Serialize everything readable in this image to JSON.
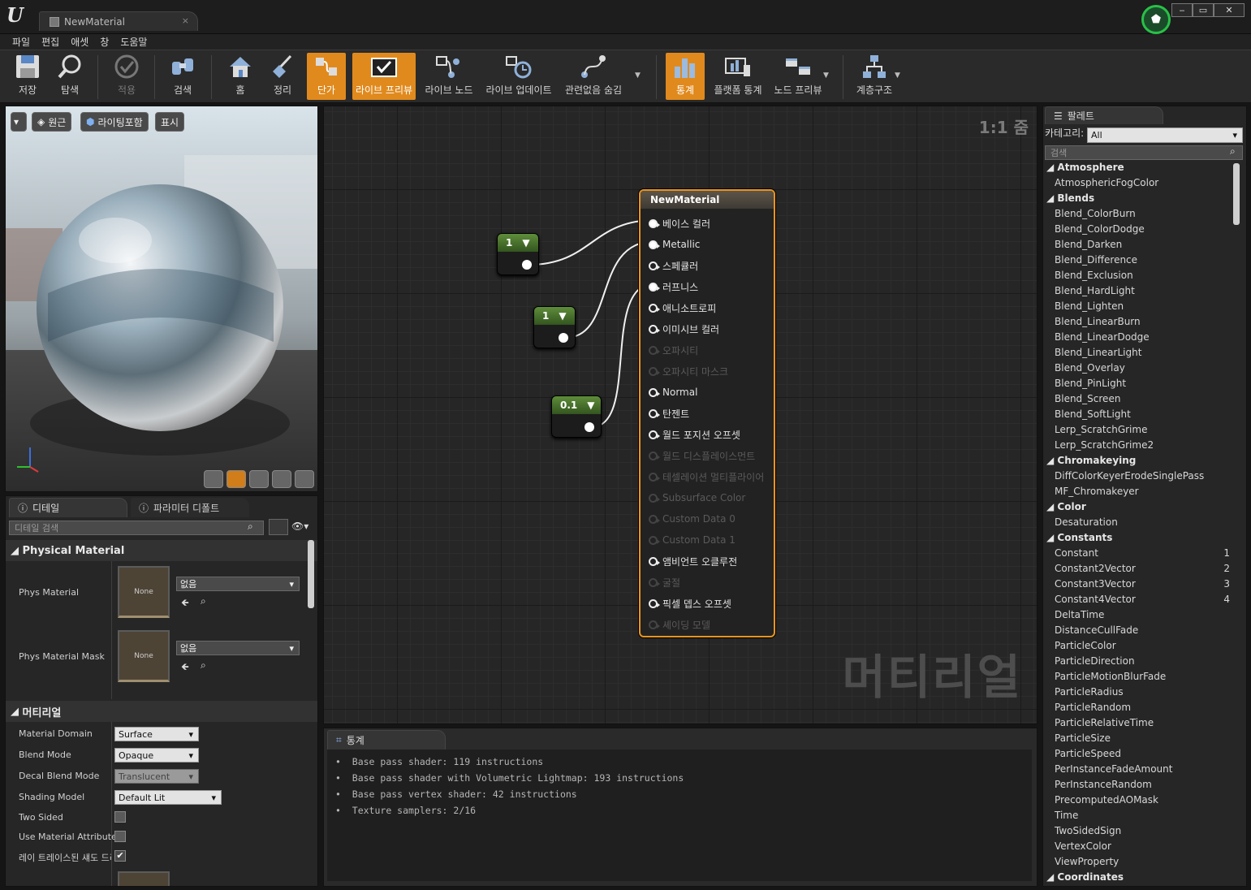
{
  "window": {
    "tab_title": "NewMaterial",
    "tab_close": "×"
  },
  "menu": [
    "파일",
    "편집",
    "애셋",
    "창",
    "도움말"
  ],
  "toolbar": {
    "save": "저장",
    "browse": "탐색",
    "apply": "적용",
    "search": "검색",
    "home": "홈",
    "clean_up": "정리",
    "connectors": "단가",
    "live_preview": "라이브 프리뷰",
    "live_nodes": "라이브 노드",
    "live_update": "라이브 업데이트",
    "hide_unrelated": "관련없음 숨김",
    "stats": "통계",
    "platform_stats": "플랫폼 통계",
    "node_preview": "노드 프리뷰",
    "hierarchy": "계층구조"
  },
  "viewport": {
    "perspective": "원근",
    "lit": "라이팅포함",
    "show": "표시"
  },
  "details": {
    "tab_details": "디테일",
    "tab_param_defaults": "파라미터 디폴트",
    "search_placeholder": "디테일 검색",
    "section_physical": "Physical Material",
    "phys_material_label": "Phys Material",
    "phys_material_thumb": "None",
    "phys_material_value": "없음",
    "phys_mask_label": "Phys Material Mask",
    "phys_mask_thumb": "None",
    "phys_mask_value": "없음",
    "section_material": "머티리얼",
    "material_domain_label": "Material Domain",
    "material_domain_value": "Surface",
    "blend_mode_label": "Blend Mode",
    "blend_mode_value": "Opaque",
    "decal_blend_label": "Decal Blend Mode",
    "decal_blend_value": "Translucent",
    "shading_model_label": "Shading Model",
    "shading_model_value": "Default Lit",
    "two_sided_label": "Two Sided",
    "use_attr_label": "Use Material Attribute",
    "raytraced_label": "레이 트레이스된 섀도 드리"
  },
  "graph": {
    "zoom": "1:1 줌",
    "watermark": "머티리얼",
    "const_nodes": [
      "1",
      "1",
      "0.1"
    ],
    "material_node_title": "NewMaterial",
    "pins": [
      {
        "label": "베이스 컬러",
        "state": "filled"
      },
      {
        "label": "Metallic",
        "state": "filled"
      },
      {
        "label": "스페큘러",
        "state": "open"
      },
      {
        "label": "러프니스",
        "state": "filled"
      },
      {
        "label": "애니소트로피",
        "state": "open"
      },
      {
        "label": "이미시브 컬러",
        "state": "open"
      },
      {
        "label": "오파시티",
        "state": "dim"
      },
      {
        "label": "오파시티 마스크",
        "state": "dim"
      },
      {
        "label": "Normal",
        "state": "open"
      },
      {
        "label": "탄젠트",
        "state": "open"
      },
      {
        "label": "월드 포지션 오프셋",
        "state": "open"
      },
      {
        "label": "월드 디스플레이스먼트",
        "state": "dim"
      },
      {
        "label": "테셀레이션 멀티플라이어",
        "state": "dim"
      },
      {
        "label": "Subsurface Color",
        "state": "dim"
      },
      {
        "label": "Custom Data 0",
        "state": "dim"
      },
      {
        "label": "Custom Data 1",
        "state": "dim"
      },
      {
        "label": "앰비언트 오클루전",
        "state": "open"
      },
      {
        "label": "굴절",
        "state": "dim"
      },
      {
        "label": "픽셀 뎁스 오프셋",
        "state": "open"
      },
      {
        "label": "셰이딩 모델",
        "state": "dim"
      }
    ]
  },
  "stats": {
    "tab": "통계",
    "lines": [
      "Base pass shader: 119 instructions",
      "Base pass shader with Volumetric Lightmap: 193 instructions",
      "Base pass vertex shader: 42 instructions",
      "Texture samplers: 2/16"
    ]
  },
  "palette": {
    "tab": "팔레트",
    "category_label": "카테고리:",
    "category_value": "All",
    "search_placeholder": "검색",
    "items": [
      {
        "t": "cat",
        "label": "Atmosphere"
      },
      {
        "t": "item",
        "label": "AtmosphericFogColor"
      },
      {
        "t": "cat",
        "label": "Blends"
      },
      {
        "t": "item",
        "label": "Blend_ColorBurn"
      },
      {
        "t": "item",
        "label": "Blend_ColorDodge"
      },
      {
        "t": "item",
        "label": "Blend_Darken"
      },
      {
        "t": "item",
        "label": "Blend_Difference"
      },
      {
        "t": "item",
        "label": "Blend_Exclusion"
      },
      {
        "t": "item",
        "label": "Blend_HardLight"
      },
      {
        "t": "item",
        "label": "Blend_Lighten"
      },
      {
        "t": "item",
        "label": "Blend_LinearBurn"
      },
      {
        "t": "item",
        "label": "Blend_LinearDodge"
      },
      {
        "t": "item",
        "label": "Blend_LinearLight"
      },
      {
        "t": "item",
        "label": "Blend_Overlay"
      },
      {
        "t": "item",
        "label": "Blend_PinLight"
      },
      {
        "t": "item",
        "label": "Blend_Screen"
      },
      {
        "t": "item",
        "label": "Blend_SoftLight"
      },
      {
        "t": "item",
        "label": "Lerp_ScratchGrime"
      },
      {
        "t": "item",
        "label": "Lerp_ScratchGrime2"
      },
      {
        "t": "cat",
        "label": "Chromakeying"
      },
      {
        "t": "item",
        "label": "DiffColorKeyerErodeSinglePass"
      },
      {
        "t": "item",
        "label": "MF_Chromakeyer"
      },
      {
        "t": "cat",
        "label": "Color"
      },
      {
        "t": "item",
        "label": "Desaturation"
      },
      {
        "t": "cat",
        "label": "Constants"
      },
      {
        "t": "item",
        "label": "Constant",
        "num": "1"
      },
      {
        "t": "item",
        "label": "Constant2Vector",
        "num": "2"
      },
      {
        "t": "item",
        "label": "Constant3Vector",
        "num": "3"
      },
      {
        "t": "item",
        "label": "Constant4Vector",
        "num": "4"
      },
      {
        "t": "item",
        "label": "DeltaTime"
      },
      {
        "t": "item",
        "label": "DistanceCullFade"
      },
      {
        "t": "item",
        "label": "ParticleColor"
      },
      {
        "t": "item",
        "label": "ParticleDirection"
      },
      {
        "t": "item",
        "label": "ParticleMotionBlurFade"
      },
      {
        "t": "item",
        "label": "ParticleRadius"
      },
      {
        "t": "item",
        "label": "ParticleRandom"
      },
      {
        "t": "item",
        "label": "ParticleRelativeTime"
      },
      {
        "t": "item",
        "label": "ParticleSize"
      },
      {
        "t": "item",
        "label": "ParticleSpeed"
      },
      {
        "t": "item",
        "label": "PerInstanceFadeAmount"
      },
      {
        "t": "item",
        "label": "PerInstanceRandom"
      },
      {
        "t": "item",
        "label": "PrecomputedAOMask"
      },
      {
        "t": "item",
        "label": "Time"
      },
      {
        "t": "item",
        "label": "TwoSidedSign"
      },
      {
        "t": "item",
        "label": "VertexColor"
      },
      {
        "t": "item",
        "label": "ViewProperty"
      },
      {
        "t": "cat",
        "label": "Coordinates"
      }
    ]
  },
  "colors": {
    "accent": "#e08a1e",
    "constant_header": "#5f8d3b",
    "selected_node_border": "#e8941e"
  }
}
